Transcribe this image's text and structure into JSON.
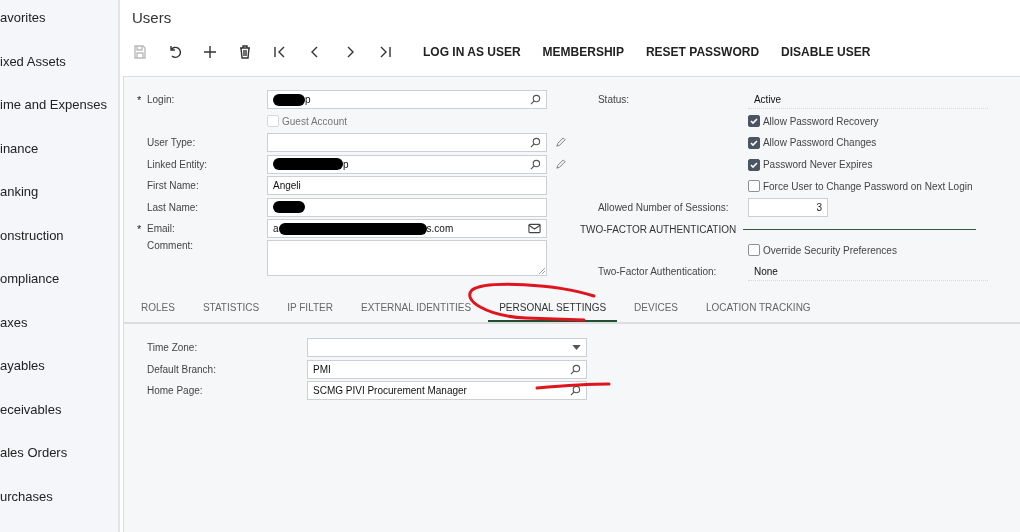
{
  "sidebar": {
    "items": [
      {
        "label": "avorites"
      },
      {
        "label": "ixed Assets"
      },
      {
        "label": "ime and Expenses"
      },
      {
        "label": "inance"
      },
      {
        "label": "anking"
      },
      {
        "label": "onstruction"
      },
      {
        "label": "ompliance"
      },
      {
        "label": "axes"
      },
      {
        "label": "ayables"
      },
      {
        "label": "eceivables"
      },
      {
        "label": "ales Orders"
      },
      {
        "label": "urchases"
      }
    ]
  },
  "page": {
    "title": "Users"
  },
  "toolbar": {
    "icons": [
      {
        "kind": "save",
        "disabled": true
      },
      {
        "kind": "undo",
        "disabled": false
      },
      {
        "kind": "add",
        "disabled": false
      },
      {
        "kind": "delete",
        "disabled": false
      },
      {
        "kind": "first",
        "disabled": false
      },
      {
        "kind": "prev",
        "disabled": false
      },
      {
        "kind": "next",
        "disabled": false
      },
      {
        "kind": "last",
        "disabled": false
      }
    ],
    "actions": [
      "LOG IN AS USER",
      "MEMBERSHIP",
      "RESET PASSWORD",
      "DISABLE USER"
    ]
  },
  "left_fields": [
    {
      "kind": "lookup",
      "label": "Login:",
      "required_mark": "*",
      "redacted": true,
      "value_after": "p",
      "edit": false
    },
    {
      "kind": "checkbox",
      "label": "Guest Account",
      "checked": false,
      "disabled": true
    },
    {
      "kind": "lookup",
      "label": "User Type:",
      "redacted": false,
      "edit": true
    },
    {
      "kind": "lookup",
      "label": "Linked Entity:",
      "redacted": true,
      "value_after": "p",
      "edit": true
    },
    {
      "kind": "text",
      "label": "First Name:",
      "redacted": false,
      "value": "Angeli",
      "edit": false
    },
    {
      "kind": "text",
      "label": "Last Name:",
      "redacted": true,
      "edit": false
    },
    {
      "kind": "email",
      "label": "Email:",
      "required_mark": "*",
      "redacted": true,
      "value": "a",
      "value_after": "s.com",
      "edit": false
    },
    {
      "kind": "textarea",
      "label": "Comment:"
    }
  ],
  "right_fields": [
    {
      "kind": "readonly",
      "label": "Status:",
      "value": "Active"
    },
    {
      "kind": "checkbox",
      "label": "Allow Password Recovery",
      "checked": true
    },
    {
      "kind": "checkbox",
      "label": "Allow Password Changes",
      "checked": true
    },
    {
      "kind": "checkbox",
      "label": "Password Never Expires",
      "checked": true
    },
    {
      "kind": "checkbox",
      "label": "Force User to Change Password on Next Login",
      "checked": false
    },
    {
      "kind": "number",
      "label": "Allowed Number of Sessions:",
      "value": "3"
    },
    {
      "kind": "section",
      "label": "TWO-FACTOR AUTHENTICATION"
    },
    {
      "kind": "checkbox",
      "label": "Override Security Preferences",
      "checked": false
    },
    {
      "kind": "readonly",
      "label": "Two-Factor Authentication:",
      "value": "None"
    }
  ],
  "tabs": [
    {
      "label": "ROLES",
      "selected": false
    },
    {
      "label": "STATISTICS",
      "selected": false
    },
    {
      "label": "IP FILTER",
      "selected": false
    },
    {
      "label": "EXTERNAL IDENTITIES",
      "selected": false
    },
    {
      "label": "PERSONAL SETTINGS",
      "selected": true
    },
    {
      "label": "DEVICES",
      "selected": false
    },
    {
      "label": "LOCATION TRACKING",
      "selected": false
    }
  ],
  "personal_settings": [
    {
      "kind": "select",
      "label": "Time Zone:"
    },
    {
      "kind": "lookup",
      "label": "Default Branch:",
      "value": "PMI"
    },
    {
      "kind": "lookup",
      "label": "Home Page:",
      "value": "SCMG PIVI Procurement Manager"
    }
  ],
  "annotations": [
    {
      "kind": "loop"
    },
    {
      "kind": "underline"
    }
  ]
}
